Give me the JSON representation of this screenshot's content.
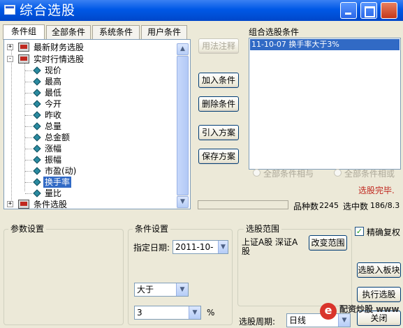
{
  "window": {
    "title": "综合选股"
  },
  "tabs": [
    "条件组",
    "全部条件",
    "系统条件",
    "用户条件"
  ],
  "tree": {
    "top_items": [
      {
        "label": "最新财务选股",
        "expander": "+"
      },
      {
        "label": "实时行情选股",
        "expander": "-"
      }
    ],
    "children": [
      "现价",
      "最高",
      "最低",
      "今开",
      "昨收",
      "总量",
      "总金额",
      "涨幅",
      "振幅",
      "市盈(动)",
      "换手率",
      "量比"
    ],
    "selected_child": "换手率",
    "bottom_item": {
      "label": "条件选股",
      "expander": "+"
    },
    "scroll_up": "▲",
    "scroll_down": "▼"
  },
  "buttons": {
    "usage_note": "用法注释",
    "add_condition": "加入条件",
    "delete_condition": "删除条件",
    "import_plan": "引入方案",
    "save_plan": "保存方案",
    "change_range": "改变范围",
    "select_into_block": "选股入板块",
    "execute": "执行选股",
    "close": "关闭"
  },
  "combo_list": {
    "label": "组合选股条件",
    "items": [
      "11-10-07  换手率大于3%"
    ]
  },
  "radios": {
    "all_and": "全部条件相与",
    "all_or": "全部条件相或"
  },
  "status": {
    "message": "选股完毕.",
    "count_label": "品种数",
    "count_value": "2245",
    "hit_label": "选中数",
    "hit_value": "186/8.3"
  },
  "param_group": {
    "label": "参数设置"
  },
  "condition_group": {
    "label": "条件设置",
    "date_label": "指定日期:",
    "date_value": "2011-10-",
    "operator": "大于",
    "value": "3",
    "unit": "%"
  },
  "range_group": {
    "label": "选股范围",
    "range_text": "上证A股 深证A股"
  },
  "period": {
    "label": "选股周期:",
    "value": "日线"
  },
  "options": {
    "exact_adjust": "精确复权",
    "exact_adjust_checked": true
  },
  "watermark": "配资炒股 www.hcdz..."
}
